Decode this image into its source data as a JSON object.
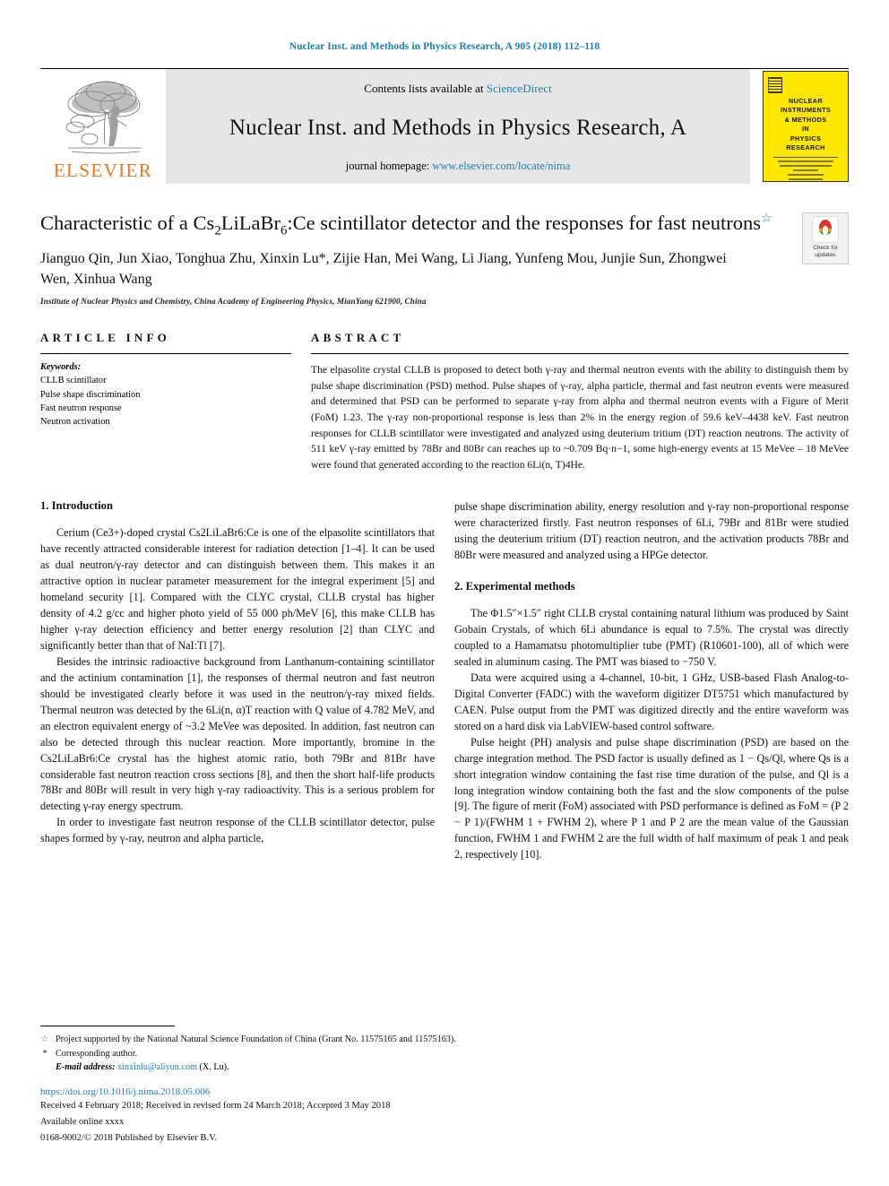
{
  "running_head": "Nuclear Inst. and Methods in Physics Research, A 905 (2018) 112–118",
  "masthead": {
    "contents_prefix": "Contents lists available at ",
    "contents_link": "ScienceDirect",
    "journal_title": "Nuclear Inst. and Methods in Physics Research, A",
    "homepage_prefix": "journal homepage: ",
    "homepage_link": "www.elsevier.com/locate/nima",
    "publisher_logo": "ELSEVIER",
    "cover": {
      "line1": "NUCLEAR",
      "line2": "INSTRUMENTS",
      "line3": "& METHODS",
      "line4": "IN",
      "line5": "PHYSICS",
      "line6": "RESEARCH"
    }
  },
  "article": {
    "title_part1": "Characteristic of a Cs",
    "title_sub1": "2",
    "title_part2": "LiLaBr",
    "title_sub2": "6",
    "title_part3": ":Ce scintillator detector and the responses for fast neutrons",
    "title_star": "☆",
    "crossmark_line1": "Check for",
    "crossmark_line2": "updates",
    "authors": "Jianguo Qin, Jun Xiao, Tonghua Zhu, Xinxin Lu*, Zijie Han, Mei Wang, Li Jiang, Yunfeng Mou, Junjie Sun, Zhongwei Wen, Xinhua Wang",
    "affiliation": "Institute of Nuclear Physics and Chemistry, China Academy of Engineering Physics, MianYang 621900, China"
  },
  "article_info": {
    "heading": "ARTICLE INFO",
    "keywords_label": "Keywords:",
    "keywords": [
      "CLLB scintillator",
      "Pulse shape discrimination",
      "Fast neutron response",
      "Neutron activation"
    ]
  },
  "abstract": {
    "heading": "ABSTRACT",
    "text": "The elpasolite crystal CLLB is proposed to detect both γ-ray and thermal neutron events with the ability to distinguish them by pulse shape discrimination (PSD) method. Pulse shapes of γ-ray, alpha particle, thermal and fast neutron events were measured and determined that PSD can be performed to separate γ-ray from alpha and thermal neutron events with a Figure of Merit (FoM) 1.23. The γ-ray non-proportional response is less than 2% in the energy region of 59.6 keV–4438 keV. Fast neutron responses for CLLB scintillator were investigated and analyzed using deuterium tritium (DT) reaction neutrons. The activity of 511 keV γ-ray emitted by 78Br and 80Br can reaches up to ~0.709 Bq·n−1, some high-energy events at 15 MeVee – 18 MeVee were found that generated according to the reaction 6Li(n, T)4He."
  },
  "body": {
    "section1_title": "1. Introduction",
    "section2_title": "2. Experimental methods",
    "left_paragraphs": [
      "Cerium (Ce3+)-doped crystal Cs2LiLaBr6:Ce is one of the elpasolite scintillators that have recently attracted considerable interest for radiation detection [1–4]. It can be used as dual neutron/γ-ray detector and can distinguish between them. This makes it an attractive option in nuclear parameter measurement for the integral experiment [5] and homeland security [1]. Compared with the CLYC crystal, CLLB crystal has higher density of 4.2 g/cc and higher photo yield of 55 000 ph/MeV [6], this make CLLB has higher γ-ray detection efficiency and better energy resolution [2] than CLYC and significantly better than that of NaI:Tl [7].",
      "Besides the intrinsic radioactive background from Lanthanum-containing scintillator and the actinium contamination [1], the responses of thermal neutron and fast neutron should be investigated clearly before it was used in the neutron/γ-ray mixed fields. Thermal neutron was detected by the 6Li(n, α)T reaction with Q value of 4.782 MeV, and an electron equivalent energy of ~3.2 MeVee was deposited. In addition, fast neutron can also be detected through this nuclear reaction. More importantly, bromine in the Cs2LiLaBr6:Ce crystal has the highest atomic ratio, both 79Br and 81Br have considerable fast neutron reaction cross sections [8], and then the short half-life products 78Br and 80Br will result in very high γ-ray radioactivity. This is a serious problem for detecting γ-ray energy spectrum.",
      "In order to investigate fast neutron response of the CLLB scintillator detector, pulse shapes formed by γ-ray, neutron and alpha particle,"
    ],
    "right_paragraphs": [
      "pulse shape discrimination ability, energy resolution and γ-ray non-proportional response were characterized firstly. Fast neutron responses of 6Li, 79Br and 81Br were studied using the deuterium tritium (DT) reaction neutron, and the activation products 78Br and 80Br were measured and analyzed using a HPGe detector.",
      "The Φ1.5″×1.5″ right CLLB crystal containing natural lithium was produced by Saint Gobain Crystals, of which 6Li abundance is equal to 7.5%. The crystal was directly coupled to a Hamamatsu photomultiplier tube (PMT) (R10601-100), all of which were sealed in aluminum casing. The PMT was biased to −750 V.",
      "Data were acquired using a 4-channel, 10-bit, 1 GHz, USB-based Flash Analog-to-Digital Converter (FADC) with the waveform digitizer DT5751 which manufactured by CAEN. Pulse output from the PMT was digitized directly and the entire waveform was stored on a hard disk via LabVIEW-based control software.",
      "Pulse height (PH) analysis and pulse shape discrimination (PSD) are based on the charge integration method. The PSD factor is usually defined as 1 − Qs/Ql, where Qs is a short integration window containing the fast rise time duration of the pulse, and Ql is a long integration window containing both the fast and the slow components of the pulse [9]. The figure of merit (FoM) associated with PSD performance is defined as FoM = (P 2 − P 1)/(FWHM 1 + FWHM 2), where P 1 and P 2 are the mean value of the Gaussian function, FWHM 1 and FWHM 2 are the full width of half maximum of peak 1 and peak 2, respectively [10]."
    ]
  },
  "footnotes": {
    "star_marker": "☆",
    "star_text": "Project supported by the National Natural Science Foundation of China (Grant No. 11575165 and 11575163).",
    "asterisk_marker": "*",
    "asterisk_text": "Corresponding author.",
    "email_label": "E-mail address:",
    "email_address": "xinxinlu@aliyun.com",
    "email_owner": "(X. Lu).",
    "doi": "https://doi.org/10.1016/j.nima.2018.05.006",
    "dates": "Received 4 February 2018; Received in revised form 24 March 2018; Accepted 3 May 2018",
    "available": "Available online xxxx",
    "copyright": "0168-9002/© 2018 Published by Elsevier B.V."
  },
  "colors": {
    "link_blue": "#1a7fb3",
    "elsevier_orange": "#E87722",
    "cover_yellow": "#FFE800",
    "masthead_gray": "#e6e6e6"
  }
}
